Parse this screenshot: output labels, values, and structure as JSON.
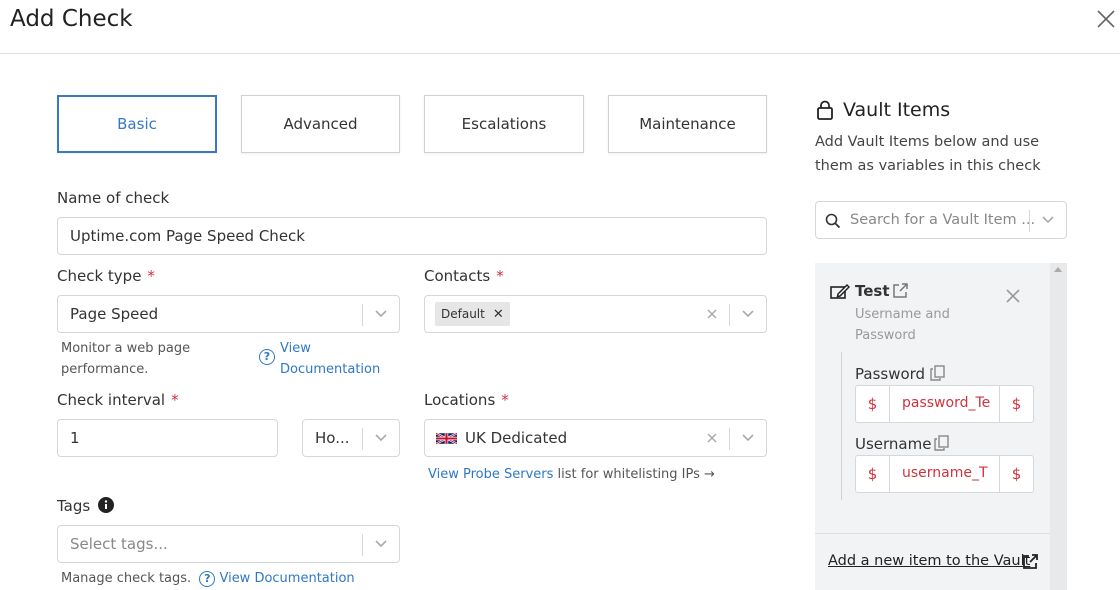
{
  "header": {
    "title": "Add Check"
  },
  "tabs": [
    {
      "label": "Basic"
    },
    {
      "label": "Advanced"
    },
    {
      "label": "Escalations"
    },
    {
      "label": "Maintenance"
    }
  ],
  "form": {
    "name_label": "Name of check",
    "name_value": "Uptime.com Page Speed Check",
    "check_type_label": "Check type",
    "check_type_value": "Page Speed",
    "check_type_help": "Monitor a web page performance.",
    "check_type_help_line1": "Monitor a web page",
    "check_type_help_line2": "performance.",
    "view_doc_line1": "View",
    "view_doc_line2": "Documentation",
    "contacts_label": "Contacts",
    "contacts_chip": "Default",
    "interval_label": "Check interval",
    "interval_value": "1",
    "interval_unit": "Ho...",
    "locations_label": "Locations",
    "locations_value": "UK Dedicated",
    "probe_link": "View Probe Servers",
    "probe_text": " list for whitelisting IPs →",
    "tags_label": "Tags",
    "tags_placeholder": "Select tags...",
    "tags_help": "Manage check tags.",
    "tags_doc_link": "View Documentation",
    "required_mark": "*"
  },
  "vault": {
    "title": "Vault Items",
    "description": "Add Vault Items below and use them as variables in this check",
    "search_placeholder": "Search for a Vault Item ...",
    "item": {
      "name": "Test",
      "type": "Username and Password",
      "password_label": "Password",
      "password_value": "password_Test",
      "password_value_visible": "password_Te",
      "username_label": "Username",
      "username_value": "username_Test",
      "username_value_visible": "username_T",
      "dollar": "$"
    },
    "add_link": "Add a new item to the Vault"
  },
  "colors": {
    "accent": "#3a79c2",
    "link": "#2f78c4",
    "required": "#d0333c"
  }
}
